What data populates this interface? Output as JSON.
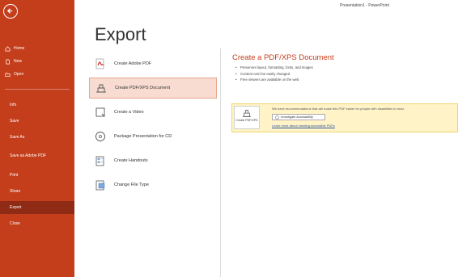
{
  "window": {
    "title": "Presentation1 - PowerPoint"
  },
  "sidebar": {
    "top_items": [
      {
        "label": "Home",
        "icon": "home-icon"
      },
      {
        "label": "New",
        "icon": "new-document-icon"
      },
      {
        "label": "Open",
        "icon": "folder-open-icon"
      }
    ],
    "items": [
      {
        "label": "Info"
      },
      {
        "label": "Save"
      },
      {
        "label": "Save As"
      },
      {
        "label": "Save as Adobe PDF"
      },
      {
        "label": "Print"
      },
      {
        "label": "Share"
      },
      {
        "label": "Export",
        "active": true
      },
      {
        "label": "Close"
      }
    ]
  },
  "main": {
    "title": "Export",
    "options": [
      {
        "label": "Create Adobe PDF",
        "icon": "adobe-pdf-icon"
      },
      {
        "label": "Create PDF/XPS Document",
        "icon": "pdf-xps-icon",
        "selected": true
      },
      {
        "label": "Create a Video",
        "icon": "video-icon"
      },
      {
        "label": "Package Presentation for CD",
        "icon": "cd-icon"
      },
      {
        "label": "Create Handouts",
        "icon": "handouts-icon"
      },
      {
        "label": "Change File Type",
        "icon": "file-type-icon"
      }
    ]
  },
  "detail": {
    "title": "Create a PDF/XPS Document",
    "bullets": [
      "Preserves layout, formatting, fonts, and images",
      "Content can't be easily changed",
      "Free viewers are available on the web"
    ],
    "notice_text": "We have recommendations that will make this PDF easier for people with disabilities to read.",
    "investigate_label": "Investigate Accessibility",
    "learn_more_link": "Learn more about creating accessible PDFs",
    "create_button_label": "Create PDF/XPS"
  },
  "colors": {
    "accent": "#c43e1c",
    "active_nav": "#8f2a14",
    "selected_bg": "#f8dcd1",
    "notice_bg": "#fff3c7"
  }
}
